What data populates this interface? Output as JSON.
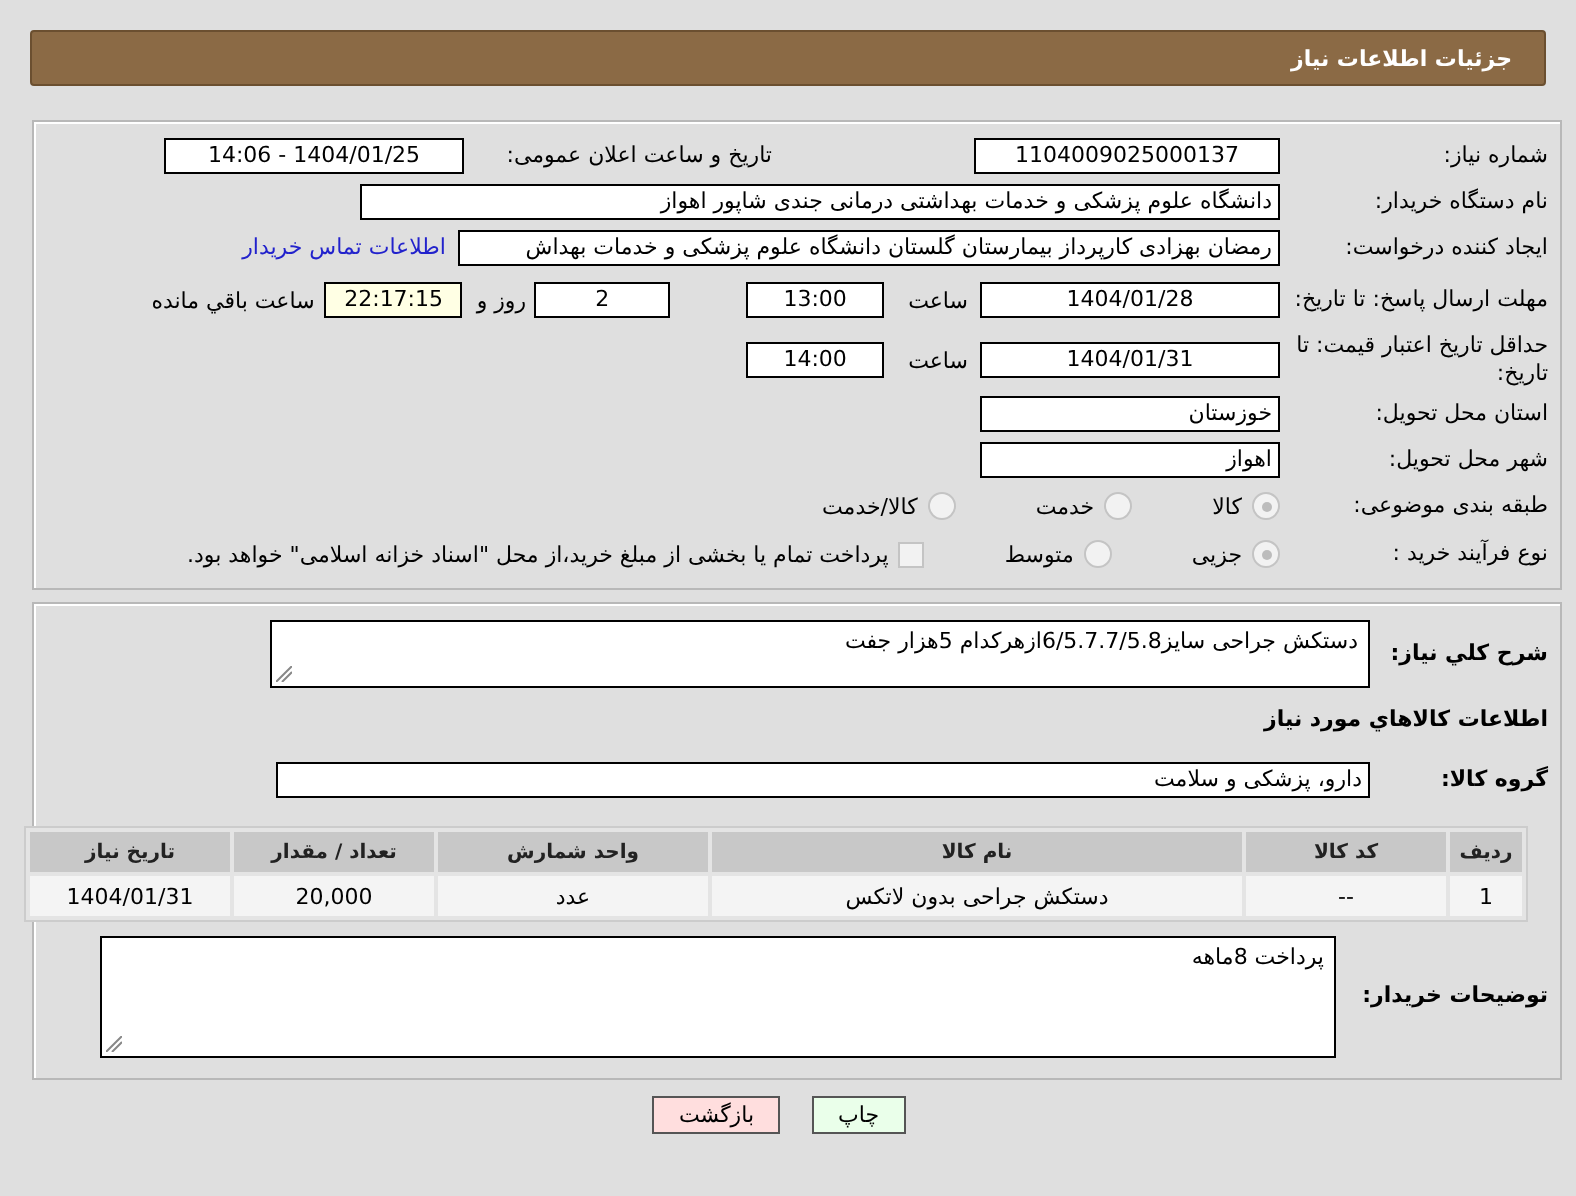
{
  "header": {
    "title": "جزئیات اطلاعات نیاز"
  },
  "need_number": {
    "label": "شماره نیاز:",
    "value": "1104009025000137"
  },
  "announce": {
    "label": "تاریخ و ساعت اعلان عمومی:",
    "value": "1404/01/25 - 14:06"
  },
  "buyer_org": {
    "label": "نام دستگاه خریدار:",
    "value": "دانشگاه علوم پزشکی و خدمات بهداشتی درمانی جندی شاپور اهواز"
  },
  "creator": {
    "label": "ایجاد کننده درخواست:",
    "value": "رمضان بهزادی کارپرداز بیمارستان گلستان دانشگاه علوم پزشکی و خدمات بهداش",
    "link": "اطلاعات تماس خریدار"
  },
  "reply_deadline": {
    "label": "مهلت ارسال پاسخ: تا تاریخ:",
    "date": "1404/01/28",
    "time_label": "ساعت",
    "time": "13:00",
    "days": "2",
    "days_label": "روز و",
    "remaining": "22:17:15",
    "remaining_label": "ساعت باقي مانده"
  },
  "price_validity": {
    "label": "حداقل تاریخ اعتبار قیمت: تا تاریخ:",
    "date": "1404/01/31",
    "time_label": "ساعت",
    "time": "14:00"
  },
  "province": {
    "label": "استان محل تحویل:",
    "value": "خوزستان"
  },
  "city": {
    "label": "شهر محل تحویل:",
    "value": "اهواز"
  },
  "category": {
    "label": "طبقه بندی موضوعی:",
    "options": [
      {
        "label": "کالا",
        "selected": true
      },
      {
        "label": "خدمت",
        "selected": false
      },
      {
        "label": "کالا/خدمت",
        "selected": false
      }
    ]
  },
  "purchase_type": {
    "label": "نوع فرآیند خرید :",
    "options": [
      {
        "label": "جزیی",
        "selected": true
      },
      {
        "label": "متوسط",
        "selected": false
      }
    ],
    "payment": {
      "label": "پرداخت تمام یا بخشی از مبلغ خرید،از محل \"اسناد خزانه اسلامی\" خواهد بود.",
      "checked": false
    }
  },
  "description": {
    "label": "شرح کلي نياز:",
    "value": "دستکش جراحی سایز6/5.7.7/5.8ازهرکدام 5هزار جفت"
  },
  "goods_title": "اطلاعات کالاهاي مورد نياز",
  "goods_group": {
    "label": "گروه کالا:",
    "value": "دارو، پزشکی و سلامت"
  },
  "table": {
    "columns": [
      "ردیف",
      "کد کالا",
      "نام کالا",
      "واحد شمارش",
      "تعداد / مقدار",
      "تاریخ نیاز"
    ],
    "rows": [
      [
        "1",
        "--",
        "دستکش جراحی بدون لاتکس",
        "عدد",
        "20,000",
        "1404/01/31"
      ]
    ]
  },
  "buyer_notes": {
    "label": "توضیحات خریدار:",
    "value": "پرداخت 8ماهه"
  },
  "buttons": [
    {
      "label": "چاپ",
      "kind": "print"
    },
    {
      "label": "بازگشت",
      "kind": "back"
    }
  ]
}
